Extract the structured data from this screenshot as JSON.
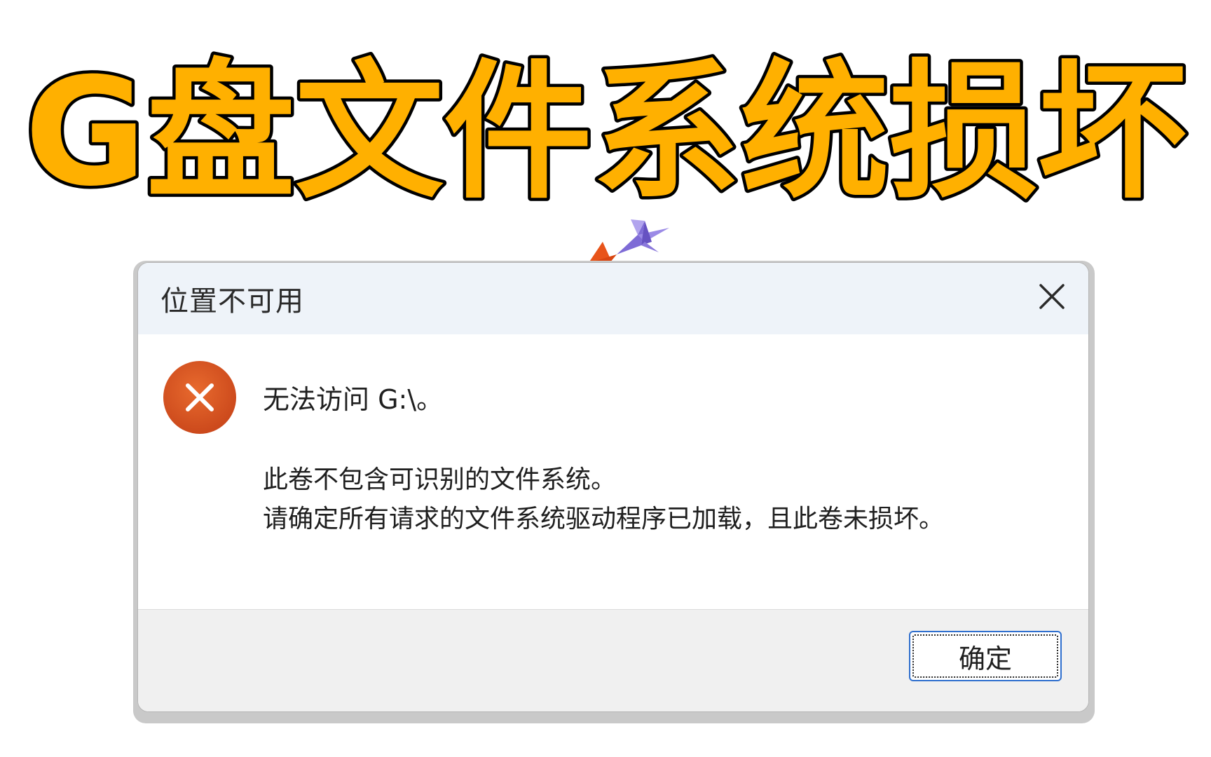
{
  "headline": {
    "text": "G盘文件系统损坏",
    "fill_color": "#FFB000",
    "stroke_color": "#000000"
  },
  "decoration": {
    "icons": [
      "orange-paper-crane-icon",
      "purple-paper-crane-icon"
    ]
  },
  "dialog": {
    "title": "位置不可用",
    "close_icon": "close-icon",
    "error_icon": "error-circle-icon",
    "error_color": "#D9531E",
    "main_instruction": "无法访问 G:\\。",
    "content_lines": [
      "此卷不包含可识别的文件系统。",
      "请确定所有请求的文件系统驱动程序已加载，且此卷未损坏。"
    ],
    "ok_label": "确定"
  }
}
